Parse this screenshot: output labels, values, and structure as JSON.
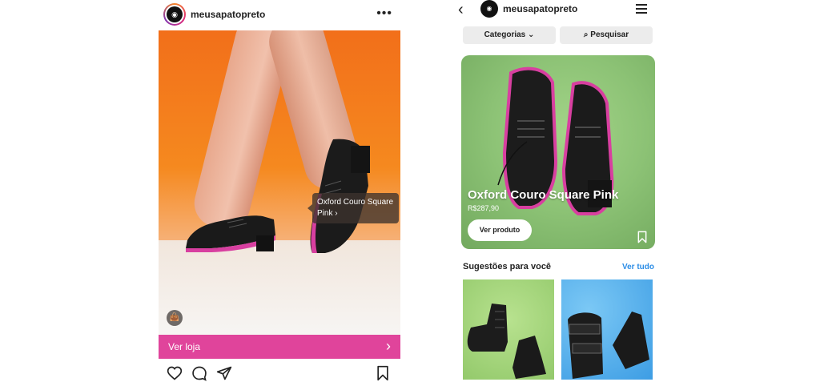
{
  "post": {
    "username": "meusapatopreto",
    "avatar_icon": "brand-logo-icon",
    "product_tag": {
      "line1": "Oxford Couro Square",
      "line2": "Pink"
    },
    "cta": {
      "label": "Ver loja",
      "icon": "chevron-right-icon"
    },
    "colors": {
      "cta_background": "#e0449b",
      "photo_background": "#f26f1a"
    }
  },
  "shop": {
    "username": "meusapatopreto",
    "filters": {
      "categories_label": "Categorias",
      "search_label": "Pesquisar"
    },
    "featured": {
      "name": "Oxford Couro Square Pink",
      "price": "R$287,90",
      "button_label": "Ver produto"
    },
    "suggestions": {
      "title": "Sugestões para você",
      "link": "Ver tudo"
    },
    "colors": {
      "link": "#2c8de6",
      "hero_background": "#8cc275"
    }
  }
}
